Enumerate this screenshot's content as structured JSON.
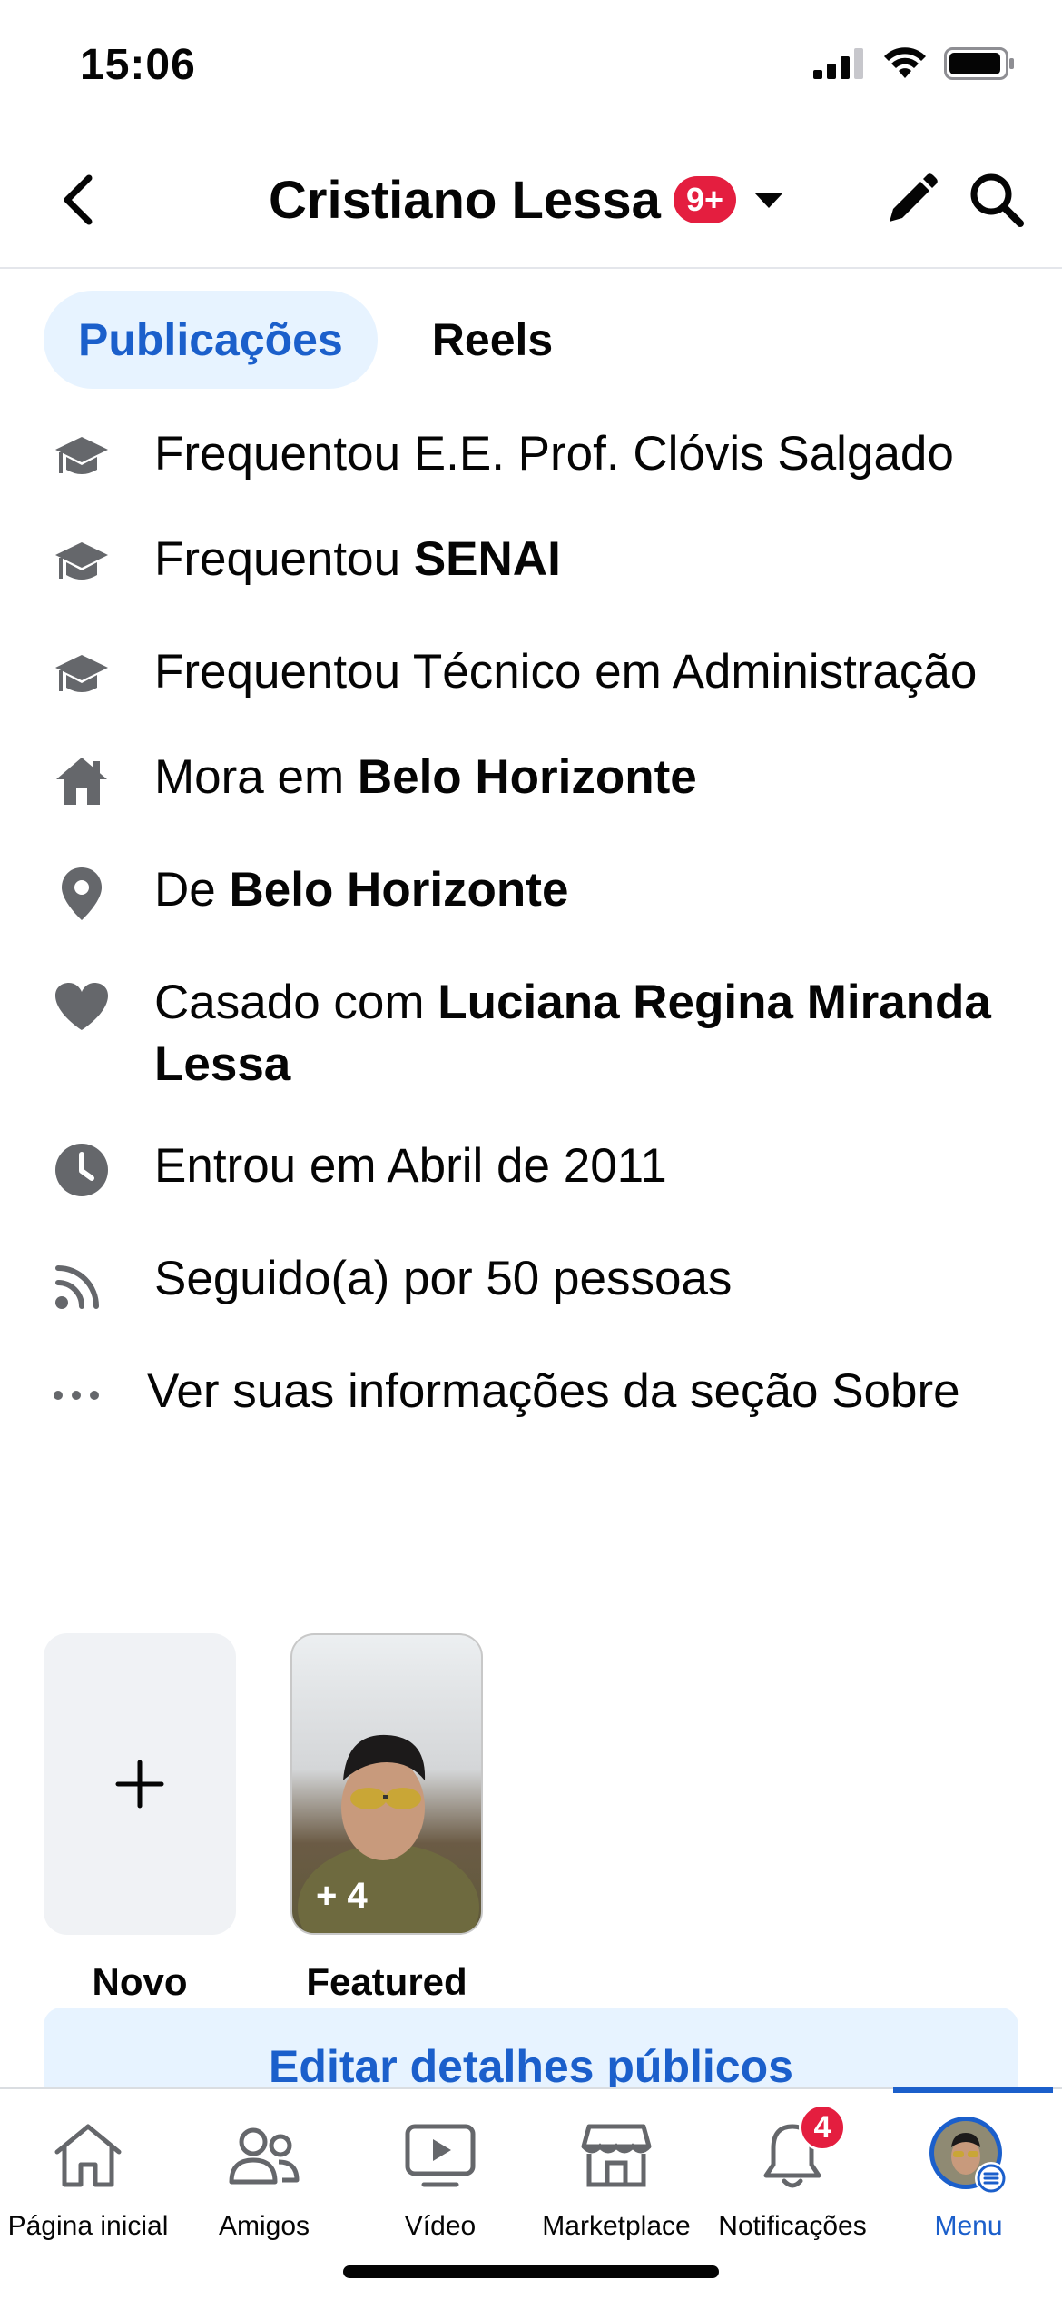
{
  "status_bar": {
    "time": "15:06"
  },
  "header": {
    "title": "Cristiano Lessa",
    "notification_badge": "9+"
  },
  "tabs": [
    {
      "label": "Publicações",
      "active": true
    },
    {
      "label": "Reels",
      "active": false
    }
  ],
  "info": [
    {
      "icon": "graduation-cap-icon",
      "prefix": "Frequentou E.E. Prof. Clóvis Salgado",
      "bold": ""
    },
    {
      "icon": "graduation-cap-icon",
      "prefix": "Frequentou ",
      "bold": "SENAI"
    },
    {
      "icon": "graduation-cap-icon",
      "prefix": "Frequentou Técnico em Administração",
      "bold": ""
    },
    {
      "icon": "home-icon",
      "prefix": "Mora em ",
      "bold": "Belo Horizonte"
    },
    {
      "icon": "location-pin-icon",
      "prefix": "De ",
      "bold": "Belo Horizonte"
    },
    {
      "icon": "heart-icon",
      "prefix": "Casado com ",
      "bold": "Luciana Regina Miranda Lessa"
    },
    {
      "icon": "clock-icon",
      "prefix": "Entrou em Abril de 2011",
      "bold": ""
    },
    {
      "icon": "rss-icon",
      "prefix": "Seguido(a) por 50 pessoas",
      "bold": ""
    },
    {
      "icon": "more-dots-icon",
      "prefix": "Ver suas informações da seção Sobre",
      "bold": ""
    }
  ],
  "highlights": {
    "new_label": "Novo",
    "featured_label": "Featured",
    "featured_count": "+ 4"
  },
  "edit_public_label": "Editar detalhes públicos",
  "bottom_nav": {
    "items": [
      {
        "label": "Página inicial",
        "icon": "home-outline-icon"
      },
      {
        "label": "Amigos",
        "icon": "friends-icon"
      },
      {
        "label": "Vídeo",
        "icon": "video-icon"
      },
      {
        "label": "Marketplace",
        "icon": "marketplace-icon"
      },
      {
        "label": "Notificações",
        "icon": "bell-icon",
        "badge": "4"
      },
      {
        "label": "Menu",
        "icon": "avatar-menu-icon",
        "active": true
      }
    ]
  },
  "colors": {
    "accent": "#1b5fcb",
    "accent_bg": "#e7f3ff",
    "badge": "#e41e3f",
    "icon_gray": "#65676b"
  }
}
